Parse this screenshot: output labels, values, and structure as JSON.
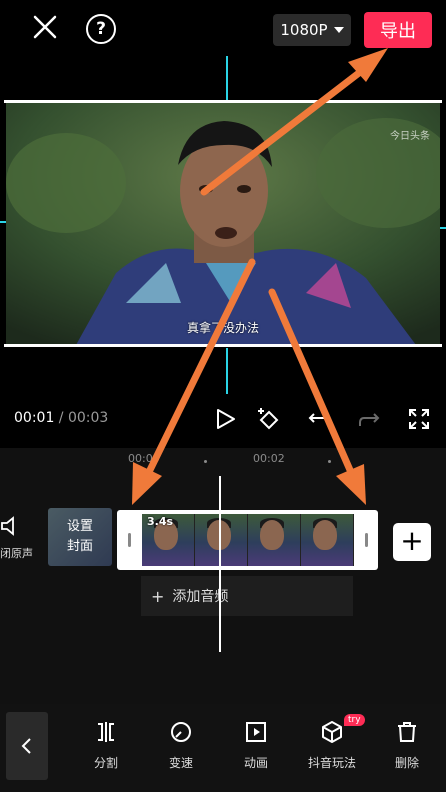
{
  "header": {
    "resolution": "1080P",
    "export_label": "导出"
  },
  "preview": {
    "watermark": "今日头条",
    "subtitle": "真拿了没办法"
  },
  "playback": {
    "current_time": "00:01",
    "separator": " / ",
    "total_time": "00:03"
  },
  "timeline": {
    "ruler_labels": [
      "00:00",
      "00:02"
    ],
    "mute_label": "闭原声",
    "cover_line1": "设置",
    "cover_line2": "封面",
    "clip_duration": "3.4s",
    "add_audio_label": "添加音频"
  },
  "toolbar": {
    "items": [
      {
        "label": "分割",
        "icon": "split-icon"
      },
      {
        "label": "变速",
        "icon": "speed-icon"
      },
      {
        "label": "动画",
        "icon": "animation-icon"
      },
      {
        "label": "抖音玩法",
        "icon": "cube-icon",
        "badge": "try"
      },
      {
        "label": "删除",
        "icon": "trash-icon"
      }
    ]
  },
  "colors": {
    "accent": "#fe2c55",
    "annotation_arrow": "#f07a3a",
    "guide_line": "#2ad4e6"
  }
}
